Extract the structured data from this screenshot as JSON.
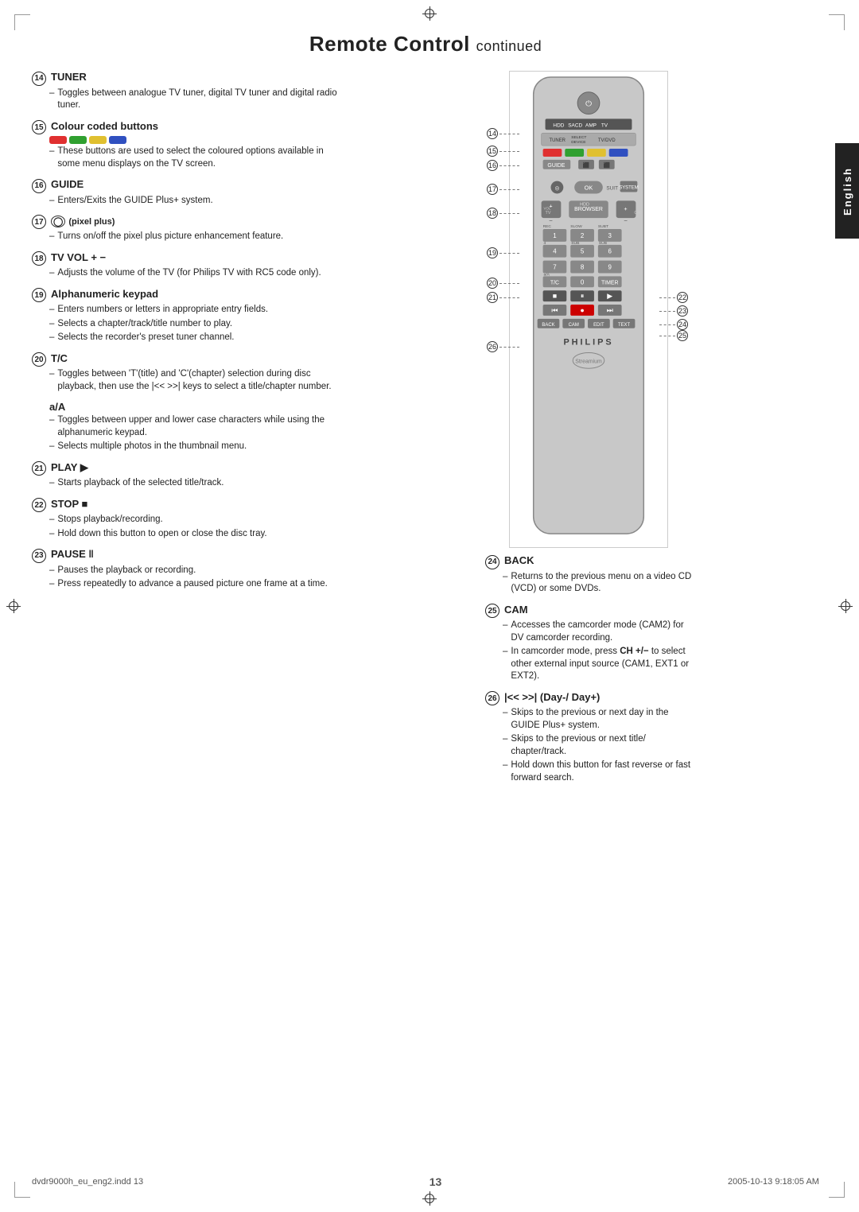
{
  "page": {
    "title": "Remote Control",
    "title_continued": "continued",
    "page_number": "13",
    "footer_left": "dvdr9000h_eu_eng2.indd  13",
    "footer_right": "2005-10-13  9:18:05 AM",
    "english_tab": "English"
  },
  "sections": [
    {
      "id": "s14",
      "num": "14",
      "title": "TUNER",
      "bullets": [
        "Toggles between analogue TV tuner, digital TV tuner and digital radio tuner."
      ]
    },
    {
      "id": "s15",
      "num": "15",
      "title": "Colour coded buttons",
      "has_colour_buttons": true,
      "bullets": [
        "These buttons are used to select the coloured options available in some menu displays on the TV screen."
      ]
    },
    {
      "id": "s16",
      "num": "16",
      "title": "GUIDE",
      "bullets": [
        "Enters/Exits the GUIDE Plus+ system."
      ]
    },
    {
      "id": "s17",
      "num": "17",
      "title": "(pixel plus)",
      "title_prefix": "",
      "has_icon": true,
      "bullets": [
        "Turns on/off the pixel plus picture enhancement feature."
      ]
    },
    {
      "id": "s18",
      "num": "18",
      "title": "TV VOL + −",
      "bullets": [
        "Adjusts the volume of the TV (for Philips TV with RC5 code only)."
      ]
    },
    {
      "id": "s19",
      "num": "19",
      "title": "Alphanumeric keypad",
      "bullets": [
        "Enters numbers or letters in appropriate entry fields.",
        "Selects a chapter/track/title number to play.",
        "Selects the recorder's preset tuner channel."
      ]
    },
    {
      "id": "s20",
      "num": "20",
      "title": "T/C",
      "bullets": [
        "Toggles between 'T'(title) and 'C'(chapter) selection during disc playback, then use the |<< >>| keys to select a title/chapter number."
      ]
    },
    {
      "id": "s_aA",
      "num": "",
      "title": "a/A",
      "is_sub": true,
      "bullets": [
        "Toggles between upper and lower case characters while using the alphanumeric keypad.",
        "Selects multiple photos in the thumbnail menu."
      ]
    },
    {
      "id": "s21",
      "num": "21",
      "title": "PLAY ▶",
      "bullets": [
        "Starts playback of the selected title/track."
      ]
    },
    {
      "id": "s22",
      "num": "22",
      "title": "STOP ■",
      "bullets": [
        "Stops playback/recording.",
        "Hold down this button to open or close the disc tray."
      ]
    },
    {
      "id": "s23",
      "num": "23",
      "title": "PAUSE ‖",
      "bullets": [
        "Pauses the playback or recording.",
        "Press repeatedly to advance a paused picture one frame at a time."
      ]
    }
  ],
  "sections_right": [
    {
      "id": "s24",
      "num": "24",
      "title": "BACK",
      "bullets": [
        "Returns to the previous menu on a video CD (VCD) or some DVDs."
      ]
    },
    {
      "id": "s25",
      "num": "25",
      "title": "CAM",
      "bullets": [
        "Accesses the camcorder mode (CAM2) for DV camcorder recording.",
        "In camcorder mode, press CH +/− to select other external input source (CAM1, EXT1 or EXT2)."
      ]
    },
    {
      "id": "s26",
      "num": "26",
      "title": "|<< >>| (Day-/ Day+)",
      "bullets": [
        "Skips to the previous or next day in the GUIDE Plus+ system.",
        "Skips to the previous or next title/ chapter/track.",
        "Hold down this button for fast reverse or fast forward search."
      ]
    }
  ],
  "colours": {
    "red": "#e03030",
    "green": "#30a030",
    "yellow": "#e0c030",
    "blue": "#3050c0"
  }
}
